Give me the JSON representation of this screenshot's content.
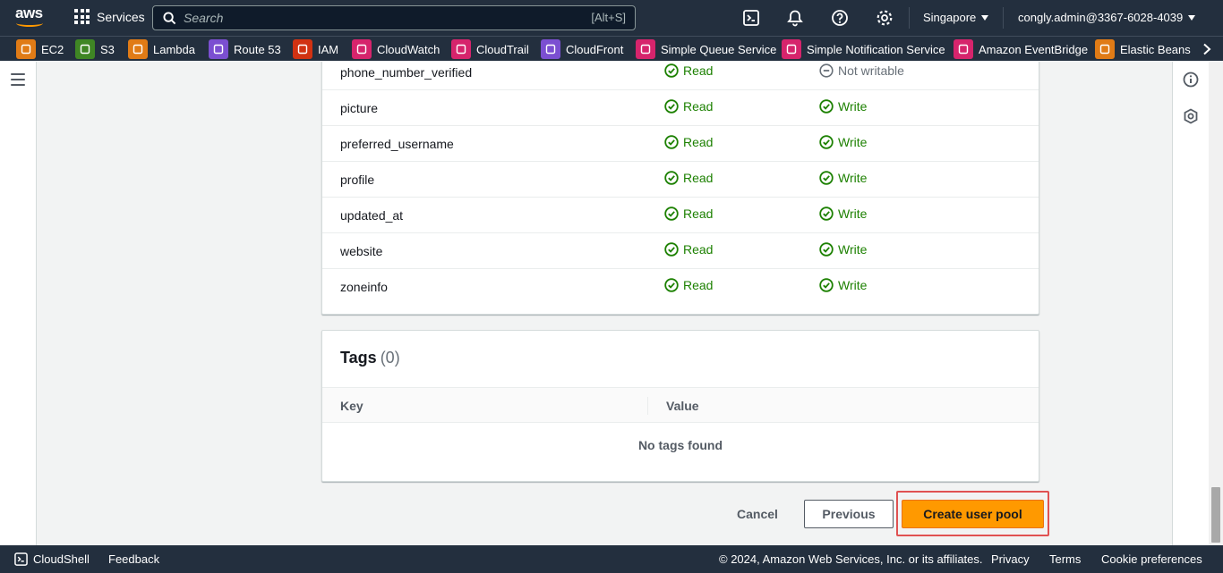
{
  "topnav": {
    "logo_text": "aws",
    "services_label": "Services",
    "search_placeholder": "Search",
    "search_shortcut": "[Alt+S]",
    "region": "Singapore",
    "account": "congly.admin@3367-6028-4039"
  },
  "favorites": [
    {
      "label": "EC2",
      "icon": "ec2-icon",
      "color": "#e07b16"
    },
    {
      "label": "S3",
      "icon": "s3-icon",
      "color": "#3f8624"
    },
    {
      "label": "Lambda",
      "icon": "lambda-icon",
      "color": "#e07b16"
    },
    {
      "label": "Route 53",
      "icon": "route53-icon",
      "color": "#7b4fd1"
    },
    {
      "label": "IAM",
      "icon": "iam-icon",
      "color": "#d13212"
    },
    {
      "label": "CloudWatch",
      "icon": "cloudwatch-icon",
      "color": "#d6246c"
    },
    {
      "label": "CloudTrail",
      "icon": "cloudtrail-icon",
      "color": "#d6246c"
    },
    {
      "label": "CloudFront",
      "icon": "cloudfront-icon",
      "color": "#7b4fd1"
    },
    {
      "label": "Simple Queue Service",
      "icon": "sqs-icon",
      "color": "#d6246c"
    },
    {
      "label": "Simple Notification Service",
      "icon": "sns-icon",
      "color": "#d6246c"
    },
    {
      "label": "Amazon EventBridge",
      "icon": "eventbridge-icon",
      "color": "#d6246c"
    },
    {
      "label": "Elastic Beans",
      "icon": "elastic-beanstalk-icon",
      "color": "#e07b16"
    }
  ],
  "attributes": [
    {
      "name": "phone_number_verified",
      "read": "Read",
      "write": "Not writable",
      "writable": false
    },
    {
      "name": "picture",
      "read": "Read",
      "write": "Write",
      "writable": true
    },
    {
      "name": "preferred_username",
      "read": "Read",
      "write": "Write",
      "writable": true
    },
    {
      "name": "profile",
      "read": "Read",
      "write": "Write",
      "writable": true
    },
    {
      "name": "updated_at",
      "read": "Read",
      "write": "Write",
      "writable": true
    },
    {
      "name": "website",
      "read": "Read",
      "write": "Write",
      "writable": true
    },
    {
      "name": "zoneinfo",
      "read": "Read",
      "write": "Write",
      "writable": true
    }
  ],
  "tags": {
    "title": "Tags",
    "count": "(0)",
    "col_key": "Key",
    "col_value": "Value",
    "empty_text": "No tags found"
  },
  "actions": {
    "cancel": "Cancel",
    "previous": "Previous",
    "create": "Create user pool"
  },
  "footer": {
    "cloudshell": "CloudShell",
    "feedback": "Feedback",
    "copyright": "© 2024, Amazon Web Services, Inc. or its affiliates.",
    "privacy": "Privacy",
    "terms": "Terms",
    "cookie": "Cookie preferences"
  },
  "colors": {
    "nav_bg": "#232f3e",
    "accent": "#ff9900",
    "success": "#1d8102",
    "highlight_outline": "#e05252"
  }
}
